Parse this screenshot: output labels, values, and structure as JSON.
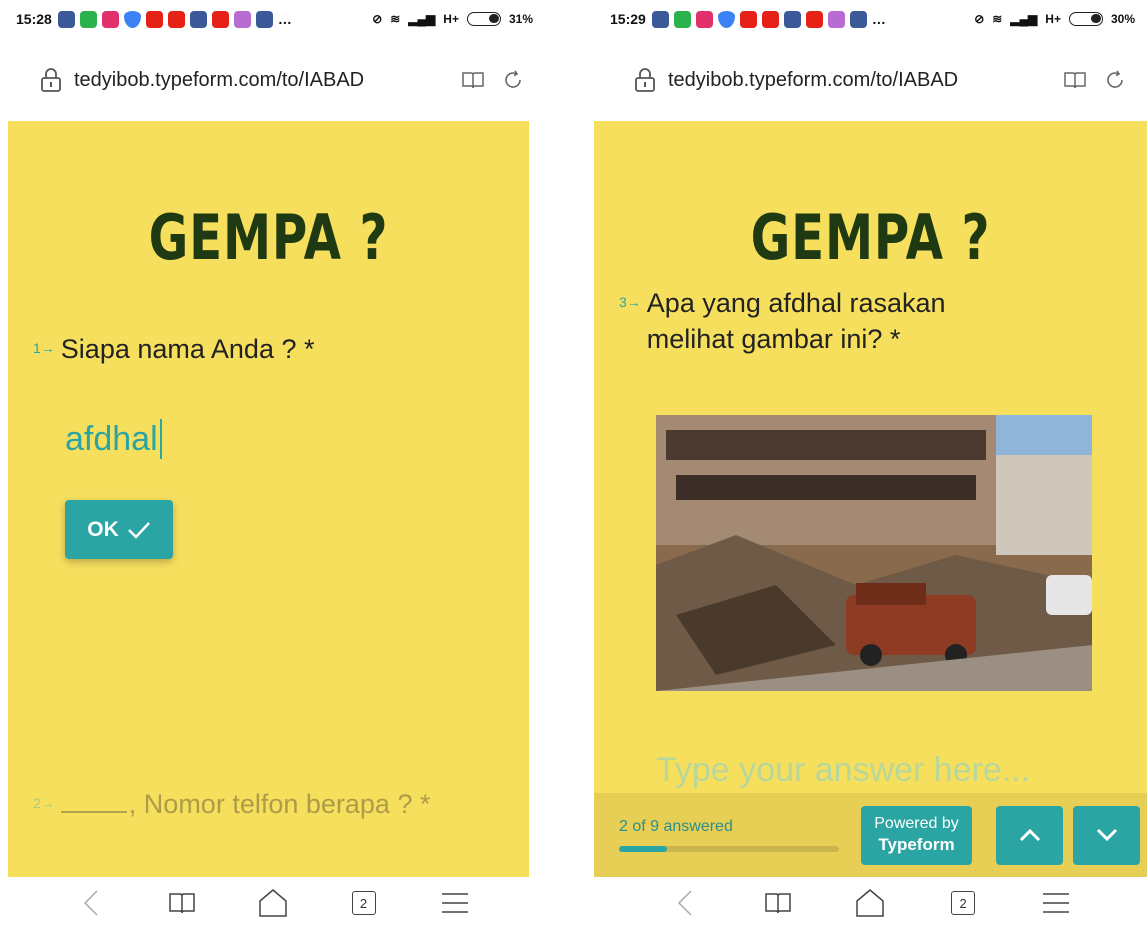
{
  "left": {
    "status_time": "15:28",
    "battery": "31%",
    "network": "H+",
    "url": "tedyibob.typeform.com/to/IABAD",
    "logo": "GEMPA ?",
    "q1_number": "1→",
    "q1_text": "Siapa nama Anda ? *",
    "answer_value": "afdhal",
    "ok_label": "OK",
    "q2_number": "2→",
    "q2_text": ", Nomor telfon berapa ? *",
    "tabs_count": "2"
  },
  "right": {
    "status_time": "15:29",
    "battery": "30%",
    "network": "H+",
    "url": "tedyibob.typeform.com/to/IABAD",
    "logo": "GEMPA ?",
    "q3_number": "3→",
    "q3_line1": "Apa yang afdhal rasakan",
    "q3_line2": "melihat gambar ini? *",
    "answer_placeholder": "Type your answer here...",
    "progress_text": "2 of 9 answered",
    "progress_value": 0.22,
    "powered_line1": "Powered by",
    "powered_line2": "Typeform",
    "tabs_count": "2"
  },
  "colors": {
    "background": "#f7df5e",
    "accent": "#2aa5a3",
    "logo": "#1f3a12",
    "bottom_bar": "#e7cf55"
  },
  "status_icons": [
    "facebook-icon",
    "phone-icon",
    "instagram-icon",
    "shield-icon",
    "youtube-icon",
    "youtube-icon",
    "facebook-icon",
    "youtube-icon",
    "game-icon",
    "facebook-icon"
  ]
}
